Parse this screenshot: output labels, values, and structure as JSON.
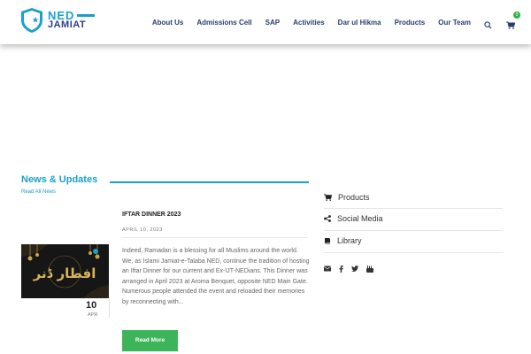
{
  "brand": {
    "line1": "NED",
    "line2": "JAMIAT",
    "primary_color": "#1aa0c8",
    "secondary_color": "#2a3d8f"
  },
  "nav": {
    "items": [
      "About Us",
      "Admissions Cell",
      "SAP",
      "Activities",
      "Dar ul Hikma",
      "Products",
      "Our Team"
    ],
    "search_icon": "search-icon",
    "cart_icon": "cart-icon",
    "cart_count": "0"
  },
  "news": {
    "title": "News & Updates",
    "read_all": "Read All News",
    "post": {
      "title": "IFTAR DINNER 2023",
      "date": "APRIL 10, 2023",
      "day": "10",
      "month": "APR",
      "image_text": "افطار ڈنر",
      "excerpt": "Indeed, Ramadan is a blessing for all Muslims around the world. We, as Islami Jamiat-e-Talaba NED, continue the tradition of hosting an Iftar Dinner for our current and Ex-IJT-NEDians. This Dinner was arranged in April 2023 at Aroma Benquet, opposite NED Main Gate. Numerous people attended the event and reloaded their memories by reconnecting with...",
      "read_more": "Read More",
      "button_color": "#3cb55a"
    }
  },
  "sidebar": {
    "items": [
      {
        "label": "Products",
        "icon": "cart-icon"
      },
      {
        "label": "Social Media",
        "icon": "share-icon"
      },
      {
        "label": "Library",
        "icon": "book-icon"
      }
    ],
    "social_icons": [
      "email-icon",
      "facebook-icon",
      "twitter-icon",
      "youtube-icon"
    ]
  }
}
